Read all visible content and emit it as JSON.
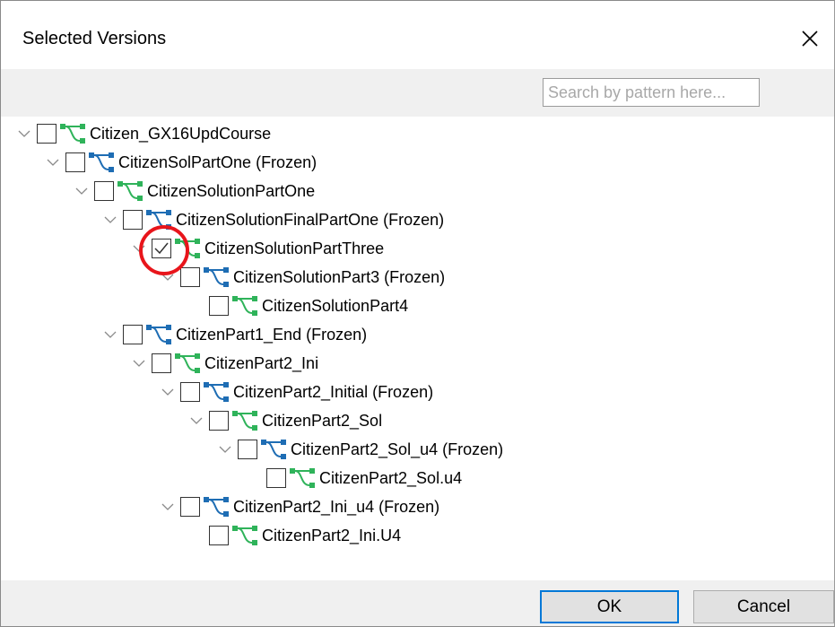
{
  "dialog": {
    "title": "Selected Versions",
    "close_icon": "close-icon"
  },
  "search": {
    "placeholder": "Search by pattern here...",
    "value": ""
  },
  "tree": {
    "items": [
      {
        "label": "Citizen_GX16UpdCourse",
        "depth": 0,
        "expanded": true,
        "has_children": true,
        "checked": false,
        "frozen": false,
        "icon": "version-green-icon"
      },
      {
        "label": "CitizenSolPartOne (Frozen)",
        "depth": 1,
        "expanded": true,
        "has_children": true,
        "checked": false,
        "frozen": true,
        "icon": "version-frozen-icon"
      },
      {
        "label": "CitizenSolutionPartOne",
        "depth": 2,
        "expanded": true,
        "has_children": true,
        "checked": false,
        "frozen": false,
        "icon": "version-green-icon"
      },
      {
        "label": "CitizenSolutionFinalPartOne (Frozen)",
        "depth": 3,
        "expanded": true,
        "has_children": true,
        "checked": false,
        "frozen": true,
        "icon": "version-frozen-icon"
      },
      {
        "label": "CitizenSolutionPartThree",
        "depth": 4,
        "expanded": true,
        "has_children": true,
        "checked": true,
        "frozen": false,
        "icon": "version-green-icon",
        "highlighted": true
      },
      {
        "label": "CitizenSolutionPart3 (Frozen)",
        "depth": 5,
        "expanded": true,
        "has_children": true,
        "checked": false,
        "frozen": true,
        "icon": "version-frozen-icon"
      },
      {
        "label": "CitizenSolutionPart4",
        "depth": 6,
        "expanded": false,
        "has_children": false,
        "checked": false,
        "frozen": false,
        "icon": "version-green-icon"
      },
      {
        "label": "CitizenPart1_End (Frozen)",
        "depth": 3,
        "expanded": true,
        "has_children": true,
        "checked": false,
        "frozen": true,
        "icon": "version-frozen-icon"
      },
      {
        "label": "CitizenPart2_Ini",
        "depth": 4,
        "expanded": true,
        "has_children": true,
        "checked": false,
        "frozen": false,
        "icon": "version-green-icon"
      },
      {
        "label": "CitizenPart2_Initial (Frozen)",
        "depth": 5,
        "expanded": true,
        "has_children": true,
        "checked": false,
        "frozen": true,
        "icon": "version-frozen-icon"
      },
      {
        "label": "CitizenPart2_Sol",
        "depth": 6,
        "expanded": true,
        "has_children": true,
        "checked": false,
        "frozen": false,
        "icon": "version-green-icon"
      },
      {
        "label": "CitizenPart2_Sol_u4 (Frozen)",
        "depth": 7,
        "expanded": true,
        "has_children": true,
        "checked": false,
        "frozen": true,
        "icon": "version-frozen-icon"
      },
      {
        "label": "CitizenPart2_Sol.u4",
        "depth": 8,
        "expanded": false,
        "has_children": false,
        "checked": false,
        "frozen": false,
        "icon": "version-green-icon"
      },
      {
        "label": "CitizenPart2_Ini_u4 (Frozen)",
        "depth": 5,
        "expanded": true,
        "has_children": true,
        "checked": false,
        "frozen": true,
        "icon": "version-frozen-icon"
      },
      {
        "label": "CitizenPart2_Ini.U4",
        "depth": 6,
        "expanded": false,
        "has_children": false,
        "checked": false,
        "frozen": false,
        "icon": "version-green-icon"
      }
    ]
  },
  "buttons": {
    "ok_label": "OK",
    "cancel_label": "Cancel"
  },
  "colors": {
    "frozen_icon": "#1e6db4",
    "version_icon": "#2fb35a",
    "highlight_circle": "#e8151b",
    "ok_border": "#0078d7"
  }
}
